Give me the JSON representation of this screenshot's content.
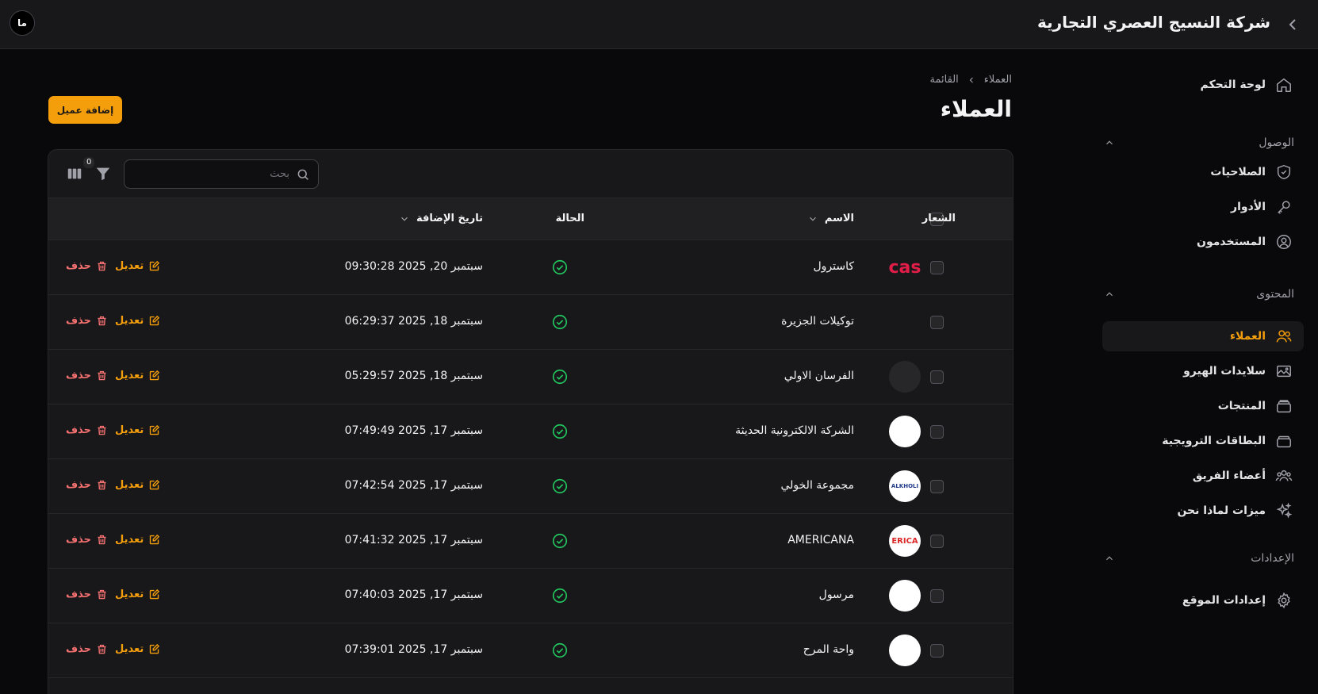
{
  "topbar": {
    "brand": "شركة النسيج العصري التجارية",
    "avatar": "ما"
  },
  "sidebar": {
    "dashboard": "لوحة التحكم",
    "groups": [
      {
        "label": "الوصول",
        "items": [
          "الصلاحيات",
          "الأدوار",
          "المستخدمون"
        ]
      },
      {
        "label": "المحتوى",
        "items": [
          "العملاء",
          "سلايدات الهيرو",
          "المنتجات",
          "البطاقات الترويجية",
          "أعضاء الفريق",
          "ميزات لماذا نحن"
        ]
      },
      {
        "label": "الإعدادات",
        "items": [
          "إعدادات الموقع"
        ]
      }
    ]
  },
  "header": {
    "breadcrumb": [
      "العملاء",
      "القائمة"
    ],
    "title": "العملاء",
    "add_button": "إضافة عميل"
  },
  "toolbar": {
    "search_placeholder": "بحث",
    "filter_count": "0"
  },
  "table": {
    "columns": {
      "logo": "الشعار",
      "name": "الاسم",
      "status": "الحالة",
      "date": "تاريخ الإضافة"
    },
    "actions": {
      "edit": "تعديل",
      "delete": "حذف"
    },
    "rows": [
      {
        "name": "كاسترول",
        "date": "سبتمبر 20, 2025 09:30:28",
        "logo_text": "cas"
      },
      {
        "name": "توكيلات الجزيرة",
        "date": "سبتمبر 18, 2025 06:29:37",
        "logo_text": ""
      },
      {
        "name": "الفرسان الاولي",
        "date": "سبتمبر 18, 2025 05:29:57",
        "logo_text": ""
      },
      {
        "name": "الشركة الالكترونية الحديثة",
        "date": "سبتمبر 17, 2025 07:49:49",
        "logo_text": ""
      },
      {
        "name": "مجموعة الخولي",
        "date": "سبتمبر 17, 2025 07:42:54",
        "logo_text": "ALKHOLI"
      },
      {
        "name": "AMERICANA",
        "date": "سبتمبر 17, 2025 07:41:32",
        "logo_text": "ERICA"
      },
      {
        "name": "مرسول",
        "date": "سبتمبر 17, 2025 07:40:03",
        "logo_text": ""
      },
      {
        "name": "واحة المرح",
        "date": "سبتمبر 17, 2025 07:39:01",
        "logo_text": ""
      }
    ]
  },
  "colors": {
    "accent": "#f59e0b",
    "success": "#22c55e",
    "danger": "#f87171"
  }
}
